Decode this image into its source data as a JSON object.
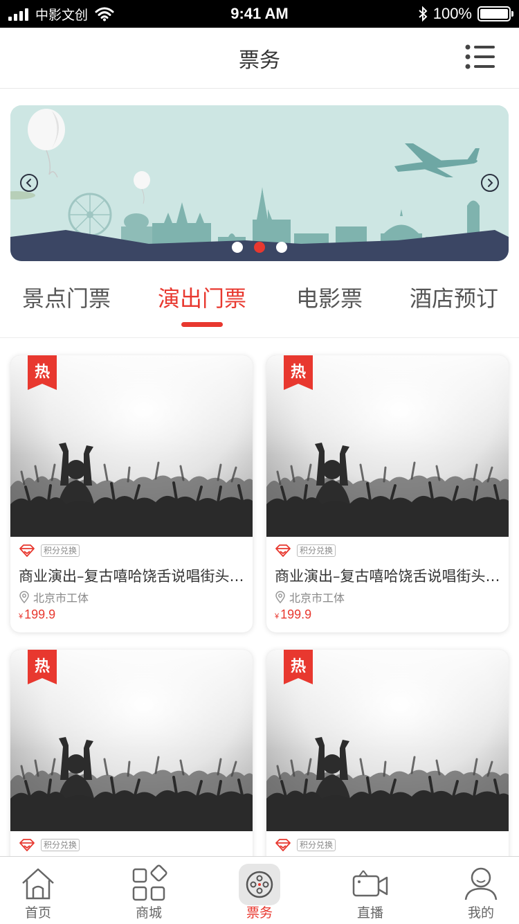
{
  "status_bar": {
    "carrier": "中影文创",
    "time": "9:41 AM",
    "battery": "100%"
  },
  "nav": {
    "title": "票务",
    "menu_icon": "list-menu-icon"
  },
  "banner": {
    "slide_count": 3,
    "active_slide": 2
  },
  "tabs": [
    {
      "label": "景点门票",
      "active": false
    },
    {
      "label": "演出门票",
      "active": true
    },
    {
      "label": "电影票",
      "active": false
    },
    {
      "label": "酒店预订",
      "active": false
    }
  ],
  "cards": [
    {
      "badge": "热",
      "tag": "积分兑换",
      "title": "商业演出–复古嘻哈饶舌说唱街头音乐节",
      "location": "北京市工体",
      "currency": "¥",
      "price": "199.9"
    },
    {
      "badge": "热",
      "tag": "积分兑换",
      "title": "商业演出–复古嘻哈饶舌说唱街头音乐节",
      "location": "北京市工体",
      "currency": "¥",
      "price": "199.9"
    },
    {
      "badge": "热",
      "tag": "积分兑换",
      "title": "",
      "location": "",
      "currency": "",
      "price": ""
    },
    {
      "badge": "热",
      "tag": "积分兑换",
      "title": "",
      "location": "",
      "currency": "",
      "price": ""
    }
  ],
  "tabbar": [
    {
      "label": "首页",
      "icon": "home-icon",
      "active": false
    },
    {
      "label": "商城",
      "icon": "grid-icon",
      "active": false
    },
    {
      "label": "票务",
      "icon": "film-reel-icon",
      "active": true
    },
    {
      "label": "直播",
      "icon": "video-camera-icon",
      "active": false
    },
    {
      "label": "我的",
      "icon": "user-icon",
      "active": false
    }
  ],
  "colors": {
    "accent": "#e8382f",
    "banner_sky": "#cde6e3",
    "skyline": "#7fb3ae",
    "ground": "#3b4664"
  }
}
